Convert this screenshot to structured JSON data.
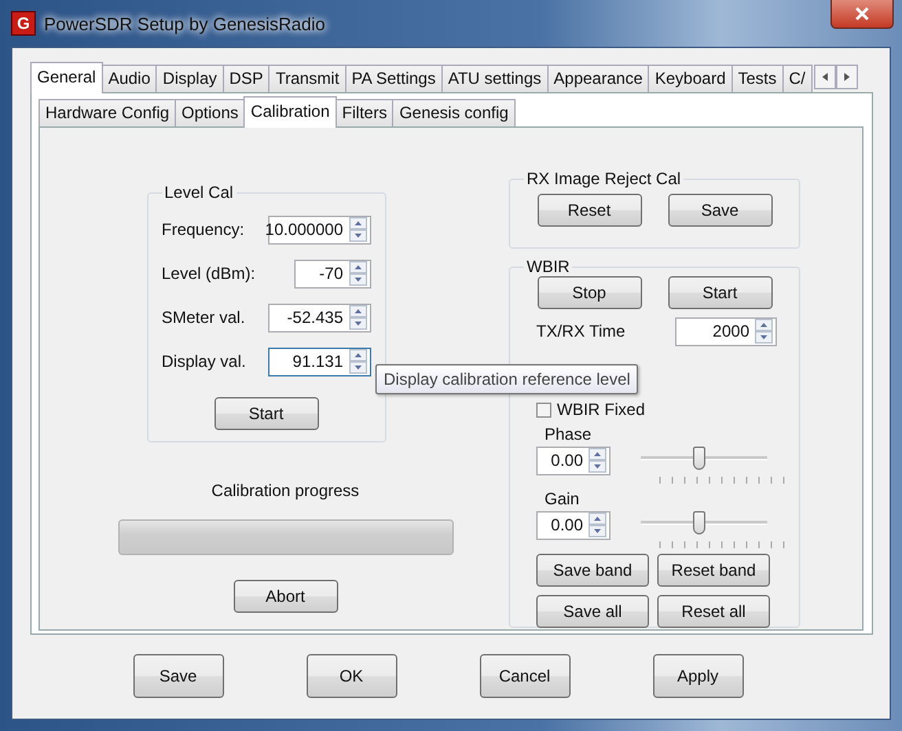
{
  "window": {
    "app_icon": "G",
    "title": "PowerSDR Setup by GenesisRadio"
  },
  "tabs": [
    {
      "label": "General",
      "selected": true
    },
    {
      "label": "Audio",
      "selected": false
    },
    {
      "label": "Display",
      "selected": false
    },
    {
      "label": "DSP",
      "selected": false
    },
    {
      "label": "Transmit",
      "selected": false
    },
    {
      "label": "PA Settings",
      "selected": false
    },
    {
      "label": "ATU settings",
      "selected": false
    },
    {
      "label": "Appearance",
      "selected": false
    },
    {
      "label": "Keyboard",
      "selected": false
    },
    {
      "label": "Tests",
      "selected": false
    },
    {
      "label": "C/",
      "selected": false
    }
  ],
  "sub_tabs": [
    {
      "label": "Hardware Config",
      "selected": false
    },
    {
      "label": "Options",
      "selected": false
    },
    {
      "label": "Calibration",
      "selected": true
    },
    {
      "label": "Filters",
      "selected": false
    },
    {
      "label": "Genesis config",
      "selected": false
    }
  ],
  "level_cal": {
    "title": "Level Cal",
    "fields": [
      {
        "label": "Frequency:",
        "value": "10.000000",
        "focused": false
      },
      {
        "label": "Level (dBm):",
        "value": "-70",
        "focused": false
      },
      {
        "label": "SMeter val.",
        "value": "-52.435",
        "focused": false
      },
      {
        "label": "Display val.",
        "value": "91.131",
        "focused": true
      }
    ],
    "button": "Start"
  },
  "calibration_progress": {
    "label": "Calibration progress",
    "level": 0
  },
  "abort_button": "Abort",
  "rx_image_reject_cal": {
    "title": "RX Image Reject Cal",
    "buttons": [
      "Reset",
      "Save"
    ]
  },
  "wbir": {
    "title": "WBIR",
    "buttons": [
      "Stop",
      "Start"
    ],
    "txrx_time": {
      "label": "TX/RX Time",
      "value": "2000"
    },
    "fixed": {
      "label": "WBIR Fixed",
      "checked": false
    },
    "sliders": [
      {
        "label": "Phase",
        "value": "0.00",
        "level": 0.47
      },
      {
        "label": "Gain",
        "value": "0.00",
        "level": 0.47
      }
    ],
    "band_buttons": [
      "Save band",
      "Reset band",
      "Save all",
      "Reset all"
    ]
  },
  "tooltip": "Display calibration reference level",
  "buttons": [
    "Save",
    "OK",
    "Cancel",
    "Apply"
  ]
}
